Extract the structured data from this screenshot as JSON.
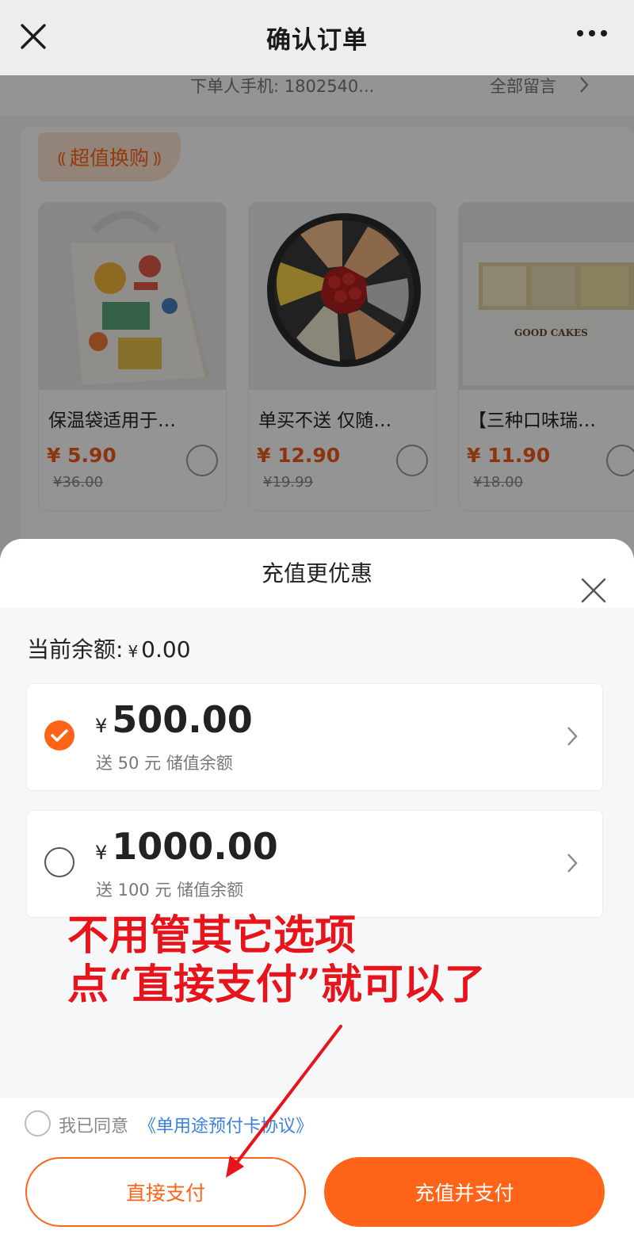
{
  "nav": {
    "title": "确认订单"
  },
  "order_info": {
    "orderer_phone": "下单人手机: 1802540...",
    "all_notes": "全部留言"
  },
  "deals": {
    "tag": "超值换购",
    "tag_ornament_left": "⸨",
    "tag_ornament_right": "⸩",
    "products": [
      {
        "name": "保温袋适用于…",
        "price": "¥ 5.90",
        "original": "¥36.00"
      },
      {
        "name": "单买不送 仅随…",
        "price": "¥ 12.90",
        "original": "¥19.99"
      },
      {
        "name": "【三种口味瑞…",
        "price": "¥ 11.90",
        "original": "¥18.00"
      }
    ],
    "cake_box_text": "GOOD CAKES"
  },
  "sheet": {
    "title": "充值更优惠",
    "balance_label": "当前余额:",
    "balance_currency": "¥",
    "balance_value": "0.00",
    "options": [
      {
        "currency": "¥",
        "amount": "500.00",
        "bonus": "送 50 元 储值余额",
        "selected": true
      },
      {
        "currency": "¥",
        "amount": "1000.00",
        "bonus": "送 100 元 储值余额",
        "selected": false
      }
    ],
    "annotation_line1": "不用管其它选项",
    "annotation_line2": "点“直接支付”就可以了",
    "agree_prefix": "我已同意",
    "agree_link": "《单用途预付卡协议》",
    "pay_direct": "直接支付",
    "pay_recharge": "充值并支付"
  },
  "colors": {
    "accent": "#ff6418",
    "link": "#3b82d8",
    "annotation": "#e8141b"
  }
}
